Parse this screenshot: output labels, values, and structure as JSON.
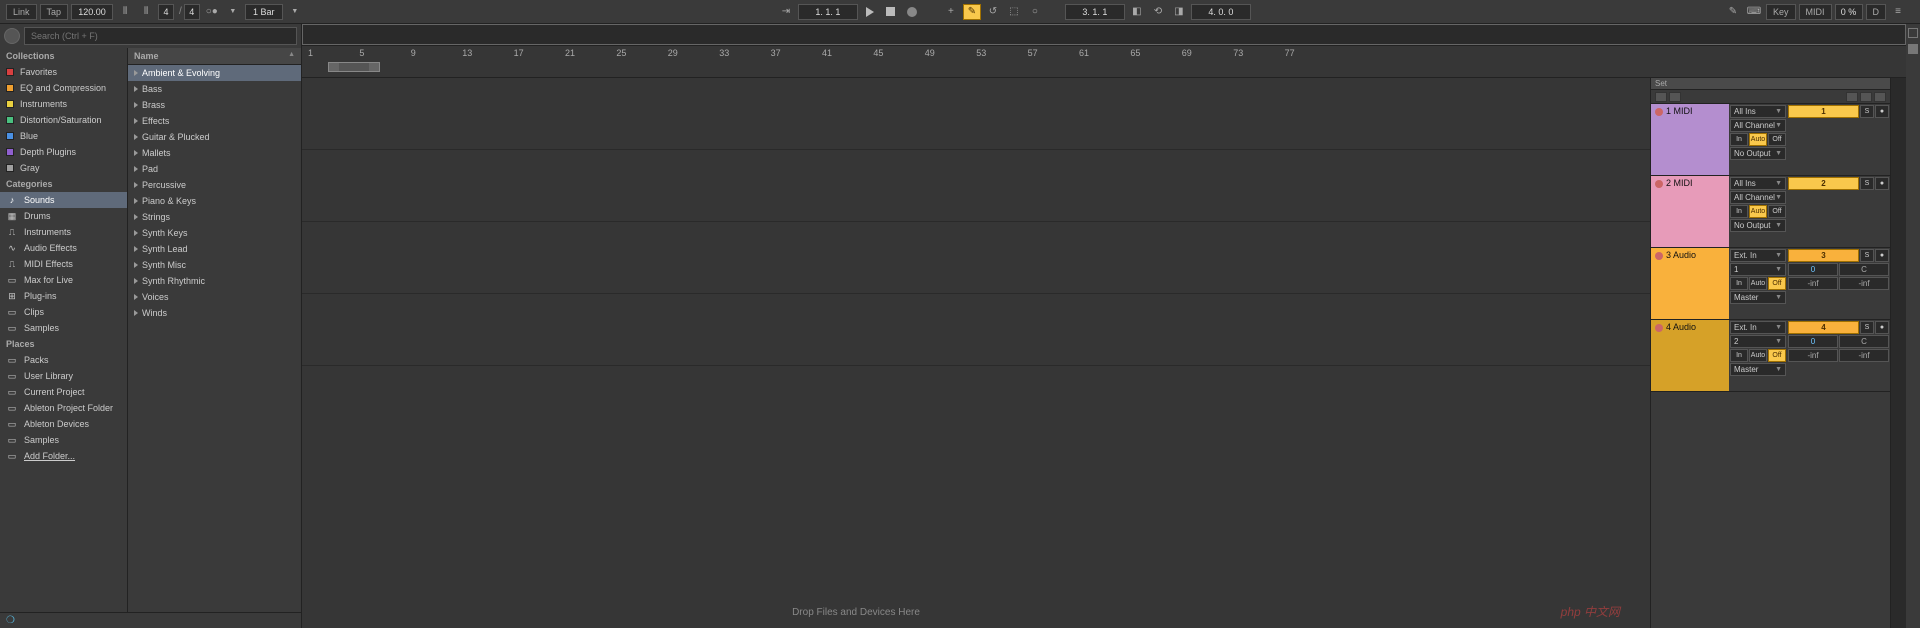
{
  "topbar": {
    "link": "Link",
    "tap": "Tap",
    "tempo": "120.00",
    "sig_num": "4",
    "sig_slash": "/",
    "sig_den": "4",
    "quantize": "1 Bar",
    "position": "1.   1.   1",
    "punch": "4.   0.   0",
    "loop": "3.   1.   1",
    "key": "Key",
    "midi": "MIDI",
    "cpu": "0 %",
    "disk": "D"
  },
  "search": {
    "placeholder": "Search (Ctrl + F)"
  },
  "collections_hdr": "Collections",
  "collections": [
    {
      "label": "Favorites",
      "color": "#d94040"
    },
    {
      "label": "EQ and Compression",
      "color": "#f0a030"
    },
    {
      "label": "Instruments",
      "color": "#e8d040"
    },
    {
      "label": "Distortion/Saturation",
      "color": "#4ac080"
    },
    {
      "label": "Blue",
      "color": "#4a90e2"
    },
    {
      "label": "Depth Plugins",
      "color": "#9060d0"
    },
    {
      "label": "Gray",
      "color": "#a0a0a0"
    }
  ],
  "categories_hdr": "Categories",
  "categories": [
    {
      "label": "Sounds",
      "selected": true
    },
    {
      "label": "Drums"
    },
    {
      "label": "Instruments"
    },
    {
      "label": "Audio Effects"
    },
    {
      "label": "MIDI Effects"
    },
    {
      "label": "Max for Live"
    },
    {
      "label": "Plug-ins"
    },
    {
      "label": "Clips"
    },
    {
      "label": "Samples"
    }
  ],
  "places_hdr": "Places",
  "places": [
    {
      "label": "Packs"
    },
    {
      "label": "User Library"
    },
    {
      "label": "Current Project"
    },
    {
      "label": "Ableton Project Folder"
    },
    {
      "label": "Ableton Devices"
    },
    {
      "label": "Samples"
    },
    {
      "label": "Add Folder...",
      "underline": true
    }
  ],
  "name_hdr": "Name",
  "sounds": [
    {
      "label": "Ambient & Evolving",
      "selected": true
    },
    {
      "label": "Bass"
    },
    {
      "label": "Brass"
    },
    {
      "label": "Effects"
    },
    {
      "label": "Guitar & Plucked"
    },
    {
      "label": "Mallets"
    },
    {
      "label": "Pad"
    },
    {
      "label": "Percussive"
    },
    {
      "label": "Piano & Keys"
    },
    {
      "label": "Strings"
    },
    {
      "label": "Synth Keys"
    },
    {
      "label": "Synth Lead"
    },
    {
      "label": "Synth Misc"
    },
    {
      "label": "Synth Rhythmic"
    },
    {
      "label": "Voices"
    },
    {
      "label": "Winds"
    }
  ],
  "ruler_ticks": [
    1,
    5,
    9,
    13,
    17,
    21,
    25,
    29,
    33,
    37,
    41,
    45,
    49,
    53,
    57,
    61,
    65,
    69,
    73,
    77
  ],
  "set_label": "Set",
  "tracks": [
    {
      "title": "1 MIDI",
      "colorClass": "t1",
      "num": "1",
      "in": "All Ins",
      "ch": "All Channel",
      "monA": "In",
      "monB": "Auto",
      "monC": "Off",
      "monSel": 1,
      "out": "No Output",
      "midi": true
    },
    {
      "title": "2 MIDI",
      "colorClass": "t2",
      "num": "2",
      "in": "All Ins",
      "ch": "All Channel",
      "monA": "In",
      "monB": "Auto",
      "monC": "Off",
      "monSel": 1,
      "out": "No Output",
      "midi": true
    },
    {
      "title": "3 Audio",
      "colorClass": "t3",
      "num": "3",
      "in": "Ext. In",
      "ch": "1",
      "monA": "In",
      "monB": "Auto",
      "monC": "Off",
      "monSel": 2,
      "out": "Master",
      "midi": false,
      "pan": "0",
      "vol": "C",
      "meterL": "-inf",
      "meterR": "-inf"
    },
    {
      "title": "4 Audio",
      "colorClass": "t4",
      "num": "4",
      "in": "Ext. In",
      "ch": "2",
      "monA": "In",
      "monB": "Auto",
      "monC": "Off",
      "monSel": 2,
      "out": "Master",
      "midi": false,
      "pan": "0",
      "vol": "C",
      "meterL": "-inf",
      "meterR": "-inf"
    }
  ],
  "drop_hint": "Drop Files and Devices Here",
  "mx_labels": {
    "s": "S",
    "dot": "●"
  }
}
